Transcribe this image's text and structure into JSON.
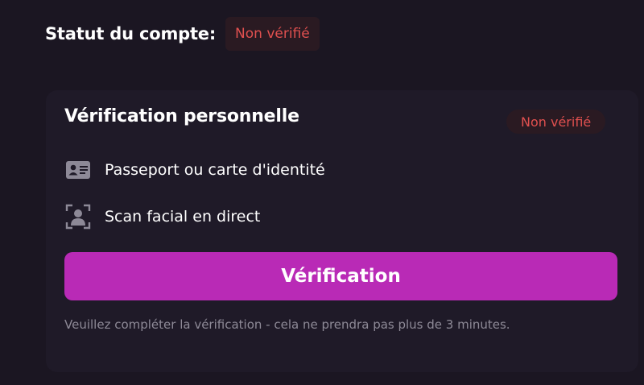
{
  "account": {
    "status_label": "Statut du compte:",
    "status_value": "Non vérifié"
  },
  "card": {
    "title": "Vérification personnelle",
    "badge": "Non vérifié",
    "requirements": [
      {
        "icon": "id-card-icon",
        "label": "Passeport ou carte d'identité"
      },
      {
        "icon": "face-scan-icon",
        "label": "Scan facial en direct"
      }
    ],
    "button_label": "Vérification",
    "note": "Veuillez compléter la vérification - cela ne prendra pas plus de 3 minutes."
  },
  "colors": {
    "background": "#1b1622",
    "card": "#1f1a28",
    "accent": "#b92ab6",
    "status_red": "#e0504f"
  }
}
